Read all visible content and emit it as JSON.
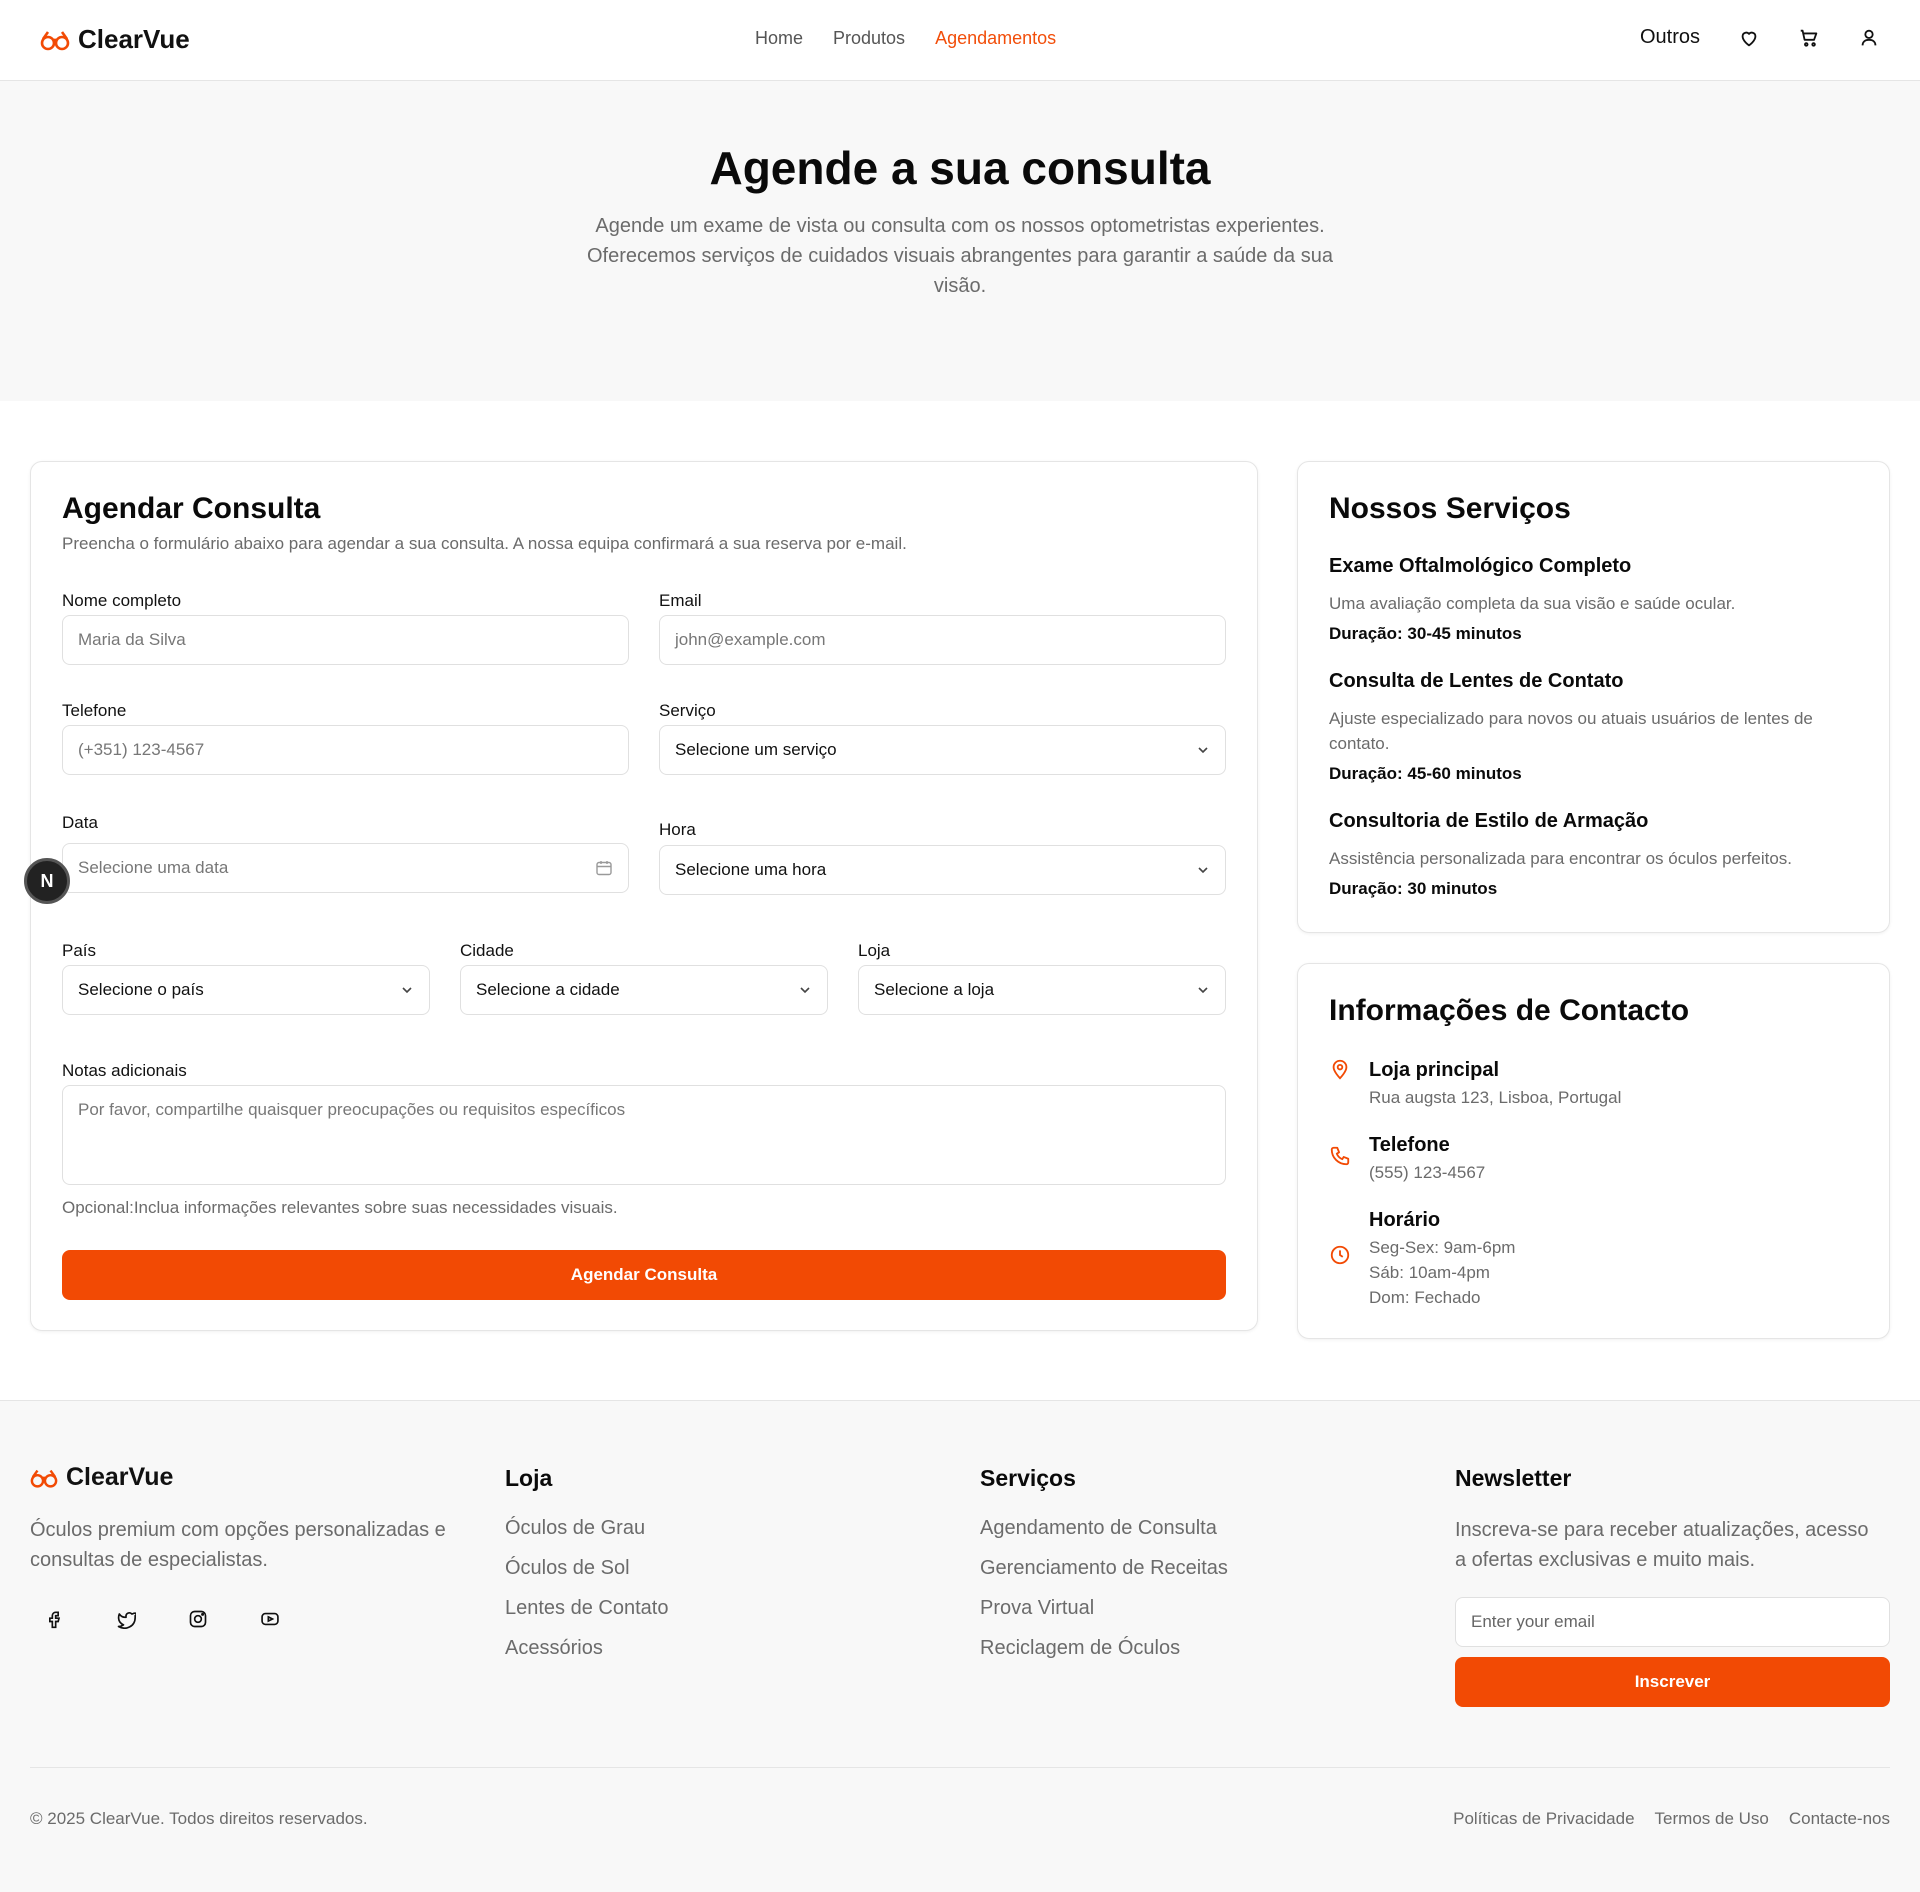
{
  "brand": {
    "name": "ClearVue",
    "accent_color": "#f24a04"
  },
  "nav": {
    "items": [
      {
        "label": "Home",
        "active": false
      },
      {
        "label": "Produtos",
        "active": false
      },
      {
        "label": "Agendamentos",
        "active": true
      }
    ],
    "outros_label": "Outros",
    "icons": [
      "heart-icon",
      "cart-icon",
      "user-icon"
    ]
  },
  "hero": {
    "title": "Agende a sua consulta",
    "subtitle": "Agende um exame de vista ou consulta com os nossos optometristas experientes. Oferecemos serviços de cuidados visuais abrangentes para garantir a saúde da sua visão."
  },
  "form": {
    "title": "Agendar Consulta",
    "subtitle": "Preencha o formulário abaixo para agendar a sua consulta. A nossa equipa confirmará a sua reserva por e-mail.",
    "name": {
      "label": "Nome completo",
      "placeholder": "Maria da Silva"
    },
    "email": {
      "label": "Email",
      "placeholder": "john@example.com"
    },
    "phone": {
      "label": "Telefone",
      "placeholder": "(+351) 123-4567"
    },
    "service": {
      "label": "Serviço",
      "value": "Selecione um serviço"
    },
    "date": {
      "label": "Data",
      "placeholder": "Selecione uma data"
    },
    "time": {
      "label": "Hora",
      "value": "Selecione uma hora"
    },
    "country": {
      "label": "País",
      "value": "Selecione o país"
    },
    "city": {
      "label": "Cidade",
      "value": "Selecione a cidade"
    },
    "store": {
      "label": "Loja",
      "value": "Selecione a loja"
    },
    "notes": {
      "label": "Notas adicionais",
      "placeholder": "Por favor, compartilhe quaisquer preocupações ou requisitos específicos",
      "help": "Opcional:Inclua informações relevantes sobre suas necessidades visuais."
    },
    "submit_label": "Agendar Consulta"
  },
  "services": {
    "title": "Nossos Serviços",
    "items": [
      {
        "name": "Exame Oftalmológico Completo",
        "description": "Uma avaliação completa da sua visão e saúde ocular.",
        "duration": "Duração: 30-45 minutos"
      },
      {
        "name": "Consulta de Lentes de Contato",
        "description": "Ajuste especializado para novos ou atuais usuários de lentes de contato.",
        "duration": "Duração: 45-60 minutos"
      },
      {
        "name": "Consultoria de Estilo de Armação",
        "description": "Assistência personalizada para encontrar os óculos perfeitos.",
        "duration": "Duração: 30 minutos"
      }
    ]
  },
  "contact": {
    "title": "Informações de Contacto",
    "store": {
      "title": "Loja principal",
      "address": "Rua augsta 123, Lisboa, Portugal"
    },
    "phone": {
      "title": "Telefone",
      "number": "(555) 123-4567"
    },
    "hours": {
      "title": "Horário",
      "lines": [
        "Seg-Sex: 9am-6pm",
        "Sáb: 10am-4pm",
        "Dom: Fechado"
      ]
    }
  },
  "badges": {
    "n_label": "N"
  },
  "footer": {
    "about": "Óculos premium com opções personalizadas e consultas de especialistas.",
    "socials": [
      "facebook-icon",
      "twitter-icon",
      "instagram-icon",
      "youtube-icon"
    ],
    "loja": {
      "title": "Loja",
      "links": [
        "Óculos de Grau",
        "Óculos de Sol",
        "Lentes de Contato",
        "Acessórios"
      ]
    },
    "servicos": {
      "title": "Serviços",
      "links": [
        "Agendamento de Consulta",
        "Gerenciamento de Receitas",
        "Prova Virtual",
        "Reciclagem de Óculos"
      ]
    },
    "newsletter": {
      "title": "Newsletter",
      "text": "Inscreva-se para receber atualizações, acesso a ofertas exclusivas e muito mais.",
      "placeholder": "Enter your email",
      "button_label": "Inscrever"
    },
    "copyright": "© 2025 ClearVue. Todos direitos reservados.",
    "legal": [
      "Políticas de Privacidade",
      "Termos de Uso",
      "Contacte-nos"
    ]
  }
}
